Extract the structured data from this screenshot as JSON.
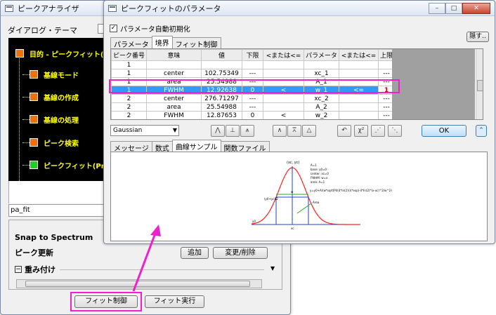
{
  "back_window": {
    "title": "ピークアナライザ",
    "tab_label": "ダイアログ・テーマ",
    "tree_items": [
      {
        "label": "目的 - ピークフィット(Pr",
        "color": "orange"
      },
      {
        "label": "基線モード",
        "color": "orange"
      },
      {
        "label": "基線の作成",
        "color": "orange"
      },
      {
        "label": "基線の処理",
        "color": "orange"
      },
      {
        "label": "ピーク検索",
        "color": "orange"
      },
      {
        "label": "ピークフィット(Pro)",
        "color": "green"
      }
    ],
    "name_field": "pa_fit",
    "snap_label": "Snap to Spectrum",
    "peak_update_label": "ピーク更新",
    "add_button": "追加",
    "modify_button": "変更/削除",
    "weight_label": "重み付け",
    "fit_control_button": "フィット制御",
    "fit_run_button": "フィット実行"
  },
  "front_window": {
    "title": "ピークフィットのパラメータ",
    "auto_init_label": "パラメータ自動初期化",
    "auto_init_checked": true,
    "hide_button": "隠す..",
    "tabs": [
      "パラメータ",
      "境界",
      "フィット制御"
    ],
    "active_tab": "境界",
    "table": {
      "headers": [
        "ピーク番号",
        "意味",
        "値",
        "下限",
        "<または<=",
        "パラメータ",
        "<または<=",
        "上限"
      ],
      "rows": [
        [
          "1",
          "",
          "",
          "",
          "",
          "",
          "",
          ""
        ],
        [
          "1",
          "center",
          "102.75349",
          "---",
          "",
          "xc_1",
          "",
          "---"
        ],
        [
          "1",
          "area",
          "25.54988",
          "---",
          "",
          "A_1",
          "",
          "---"
        ],
        [
          "1",
          "FWHM",
          "12.92638",
          "0",
          "<",
          "w_1",
          "<=",
          "1"
        ],
        [
          "2",
          "center",
          "276.71297",
          "---",
          "",
          "xc_2",
          "",
          "---"
        ],
        [
          "2",
          "area",
          "25.54988",
          "---",
          "",
          "A_2",
          "",
          "---"
        ],
        [
          "2",
          "FWHM",
          "12.87653",
          "0",
          "<",
          "w_2",
          "",
          "---"
        ]
      ],
      "selected_row": 3
    },
    "function_select": "Gaussian",
    "ok_button": "OK",
    "lower_tabs": [
      "メッセージ",
      "数式",
      "曲線サンプル",
      "関数ファイル"
    ],
    "active_lower_tab": "曲線サンプル",
    "sample": {
      "peak_label": "(xc, yc)",
      "info_lines": [
        "A=1",
        "base: y0=0",
        "center: xc=0",
        "FWHM: w=x",
        "area: A=1"
      ],
      "formula": "y=y0+A/(w*sqrt(PI/(4*ln(2))))*exp(-4*ln(2)*(x-xc)^2/w^2)",
      "area_label": "Area",
      "half_label": "(y0+yc)/2",
      "w_label": "w",
      "y0_label": "y0",
      "xc_label": "xc",
      "colors": {
        "curve": "#ff2020",
        "area_pointer": "#22aa22",
        "guide": "#2244cc"
      }
    }
  },
  "highlight_color": "#ee22cc"
}
